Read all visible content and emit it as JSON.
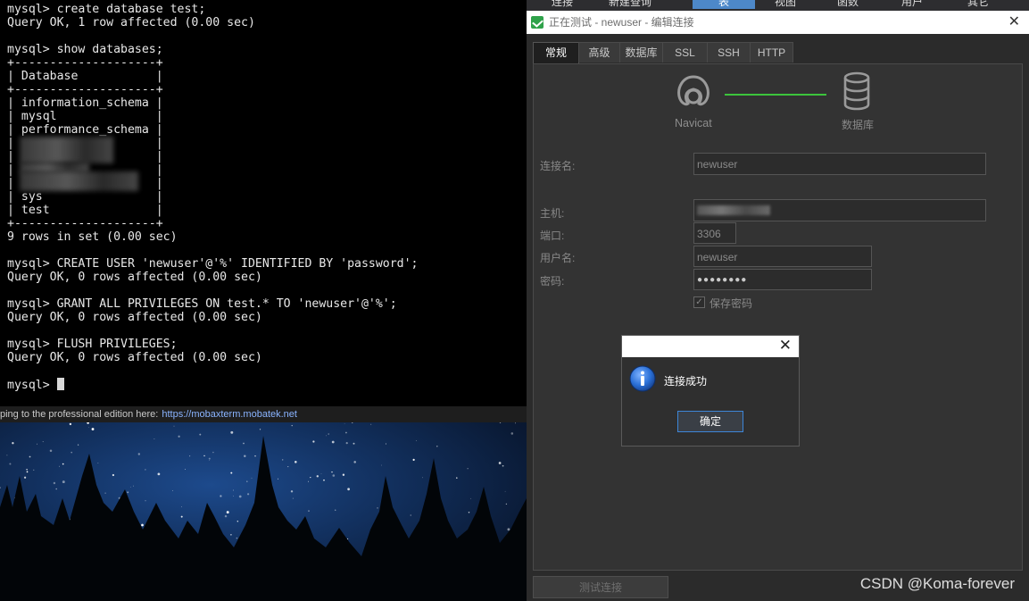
{
  "terminal": {
    "lines": [
      "mysql> create database test;",
      "Query OK, 1 row affected (0.00 sec)",
      "",
      "mysql> show databases;",
      "+--------------------+",
      "| Database           |",
      "+--------------------+",
      "| information_schema |",
      "| mysql              |",
      "| performance_schema |",
      "|                    |",
      "|                    |",
      "|                    |",
      "|                    |",
      "| sys                |",
      "| test               |",
      "+--------------------+",
      "9 rows in set (0.00 sec)",
      "",
      "mysql> CREATE USER 'newuser'@'%' IDENTIFIED BY 'password';",
      "Query OK, 0 rows affected (0.00 sec)",
      "",
      "mysql> GRANT ALL PRIVILEGES ON test.* TO 'newuser'@'%';",
      "Query OK, 0 rows affected (0.00 sec)",
      "",
      "mysql> FLUSH PRIVILEGES;",
      "Query OK, 0 rows affected (0.00 sec)",
      "",
      "mysql> "
    ]
  },
  "mobaxterm": {
    "upgrade_text": "ping to the professional edition here:",
    "url": "https://mobaxterm.mobatek.net"
  },
  "navicat_toolbar": {
    "items": [
      "连接",
      "新建查询",
      "表",
      "视图",
      "函数",
      "用户",
      "其它"
    ]
  },
  "dialog": {
    "title": "正在测试 - newuser - 编辑连接",
    "tabs": [
      "常规",
      "高级",
      "数据库",
      "SSL",
      "SSH",
      "HTTP"
    ],
    "active_tab": "常规",
    "diagram": {
      "left_label": "Navicat",
      "right_label": "数据库",
      "link_color": "#3cc43c"
    },
    "form": {
      "connection_name_label": "连接名:",
      "connection_name_value": "newuser",
      "host_label": "主机:",
      "port_label": "端口:",
      "port_value": "3306",
      "username_label": "用户名:",
      "username_value": "newuser",
      "password_label": "密码:",
      "password_value": "●●●●●●●●",
      "save_password_label": "保存密码",
      "save_password_checked": true
    },
    "test_button": "测试连接"
  },
  "message_box": {
    "text": "连接成功",
    "ok_button": "确定"
  },
  "watermark": "CSDN @Koma-forever"
}
